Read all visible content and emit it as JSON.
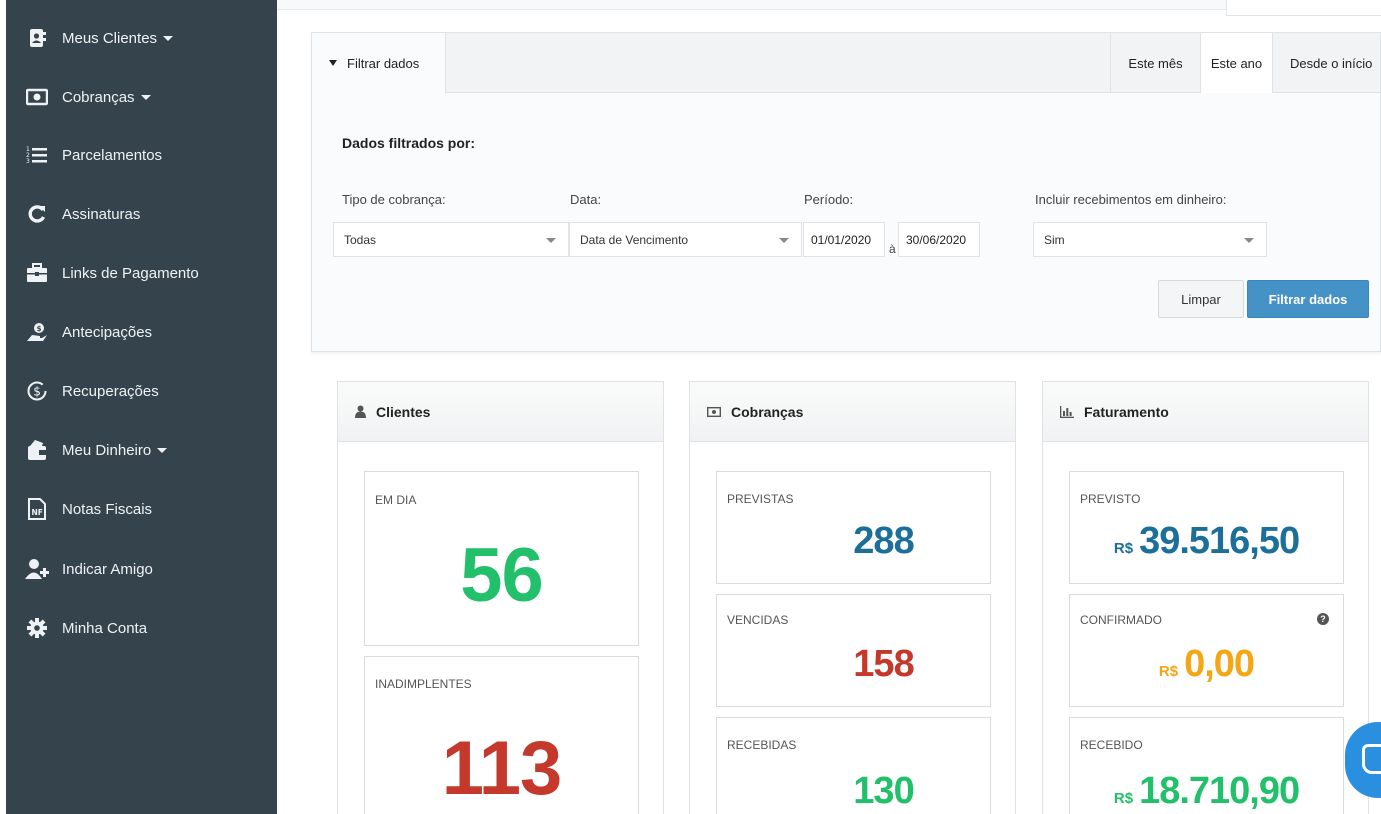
{
  "sidebar": {
    "items": [
      {
        "label": "Meus Clientes",
        "icon": "contacts-book-icon",
        "has_caret": true
      },
      {
        "label": "Cobranças",
        "icon": "banknote-icon",
        "has_caret": true
      },
      {
        "label": "Parcelamentos",
        "icon": "numbered-list-icon",
        "has_caret": false
      },
      {
        "label": "Assinaturas",
        "icon": "refresh-icon",
        "has_caret": false
      },
      {
        "label": "Links de Pagamento",
        "icon": "briefcase-icon",
        "has_caret": false
      },
      {
        "label": "Antecipações",
        "icon": "hand-coin-icon",
        "has_caret": false
      },
      {
        "label": "Recuperações",
        "icon": "recover-money-icon",
        "has_caret": false
      },
      {
        "label": "Meu Dinheiro",
        "icon": "wallet-icon",
        "has_caret": true
      },
      {
        "label": "Notas Fiscais",
        "icon": "invoice-nf-icon",
        "has_caret": false
      },
      {
        "label": "Indicar Amigo",
        "icon": "add-user-icon",
        "has_caret": false
      },
      {
        "label": "Minha Conta",
        "icon": "gear-icon",
        "has_caret": false
      }
    ]
  },
  "filter": {
    "toggle_label": "Filtrar dados",
    "period_tabs": [
      {
        "label": "Este mês",
        "active": false
      },
      {
        "label": "Este ano",
        "active": true
      },
      {
        "label": "Desde o início",
        "active": false
      }
    ],
    "title": "Dados filtrados por:",
    "tipo_label": "Tipo de cobrança:",
    "tipo_value": "Todas",
    "data_label": "Data:",
    "data_value": "Data de Vencimento",
    "periodo_label": "Período:",
    "periodo_start": "01/01/2020",
    "periodo_sep": "à",
    "periodo_end": "30/06/2020",
    "dinheiro_label": "Incluir recebimentos em dinheiro:",
    "dinheiro_value": "Sim",
    "clear_label": "Limpar",
    "submit_label": "Filtrar dados"
  },
  "cards": {
    "clientes": {
      "title": "Clientes",
      "em_dia_label": "EM DIA",
      "em_dia_value": "56",
      "inadimplentes_label": "INADIMPLENTES",
      "inadimplentes_value": "113"
    },
    "cobrancas": {
      "title": "Cobranças",
      "previstas_label": "PREVISTAS",
      "previstas_value": "288",
      "vencidas_label": "VENCIDAS",
      "vencidas_value": "158",
      "recebidas_label": "RECEBIDAS",
      "recebidas_value": "130"
    },
    "faturamento": {
      "title": "Faturamento",
      "currency": "R$",
      "previsto_label": "PREVISTO",
      "previsto_value": "39.516,50",
      "confirmado_label": "CONFIRMADO",
      "confirmado_value": "0,00",
      "recebido_label": "RECEBIDO",
      "recebido_value": "18.710,90"
    }
  },
  "colors": {
    "sidebar_bg": "#35434d",
    "green": "#22c06a",
    "red": "#c4392b",
    "blue": "#1c6f9a",
    "orange": "#f5a615",
    "primary_button": "#4592c7"
  }
}
